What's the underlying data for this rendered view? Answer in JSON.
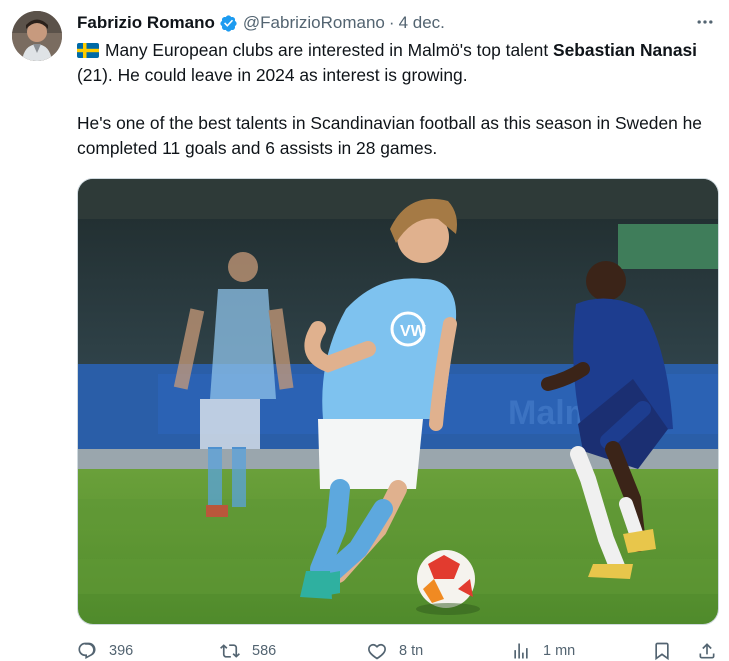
{
  "tweet": {
    "author_name": "Fabrizio Romano",
    "author_handle": "@FabrizioRomano",
    "separator": "·",
    "date": "4 dec.",
    "paragraph1": {
      "text_before": "Many European clubs are interested in Malmö's top talent ",
      "bold_name": "Sebastian Nanasi",
      "text_after": " (21). He could leave in 2024 as interest is growing."
    },
    "paragraph2": "He's one of the best talents in Scandinavian football as this season in Sweden he completed 11 goals and 6 assists in 28 games.",
    "flag_icon": "sweden-flag-emoji",
    "verified_color": "#1d9bf0",
    "image_alt": ""
  },
  "actions": {
    "replies": "396",
    "reposts": "586",
    "likes": "8 tn",
    "views": "1 mn"
  },
  "colors": {
    "text": "#0f1419",
    "secondary": "#536471",
    "accent": "#1d9bf0"
  }
}
